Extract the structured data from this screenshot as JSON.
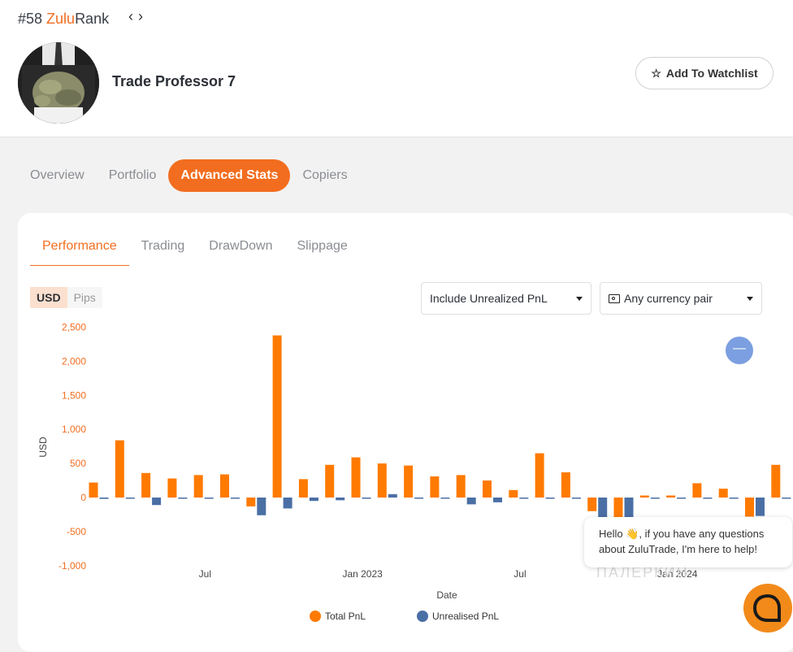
{
  "header": {
    "rank_prefix": "#58 ",
    "rank_brand": "Zulu",
    "rank_suffix": "Rank",
    "trader_name": "Trade Professor 7",
    "watchlist_label": "Add To Watchlist"
  },
  "tabs": [
    "Overview",
    "Portfolio",
    "Advanced Stats",
    "Copiers"
  ],
  "subtabs": [
    "Performance",
    "Trading",
    "DrawDown",
    "Slippage"
  ],
  "unit_toggle": {
    "usd": "USD",
    "pips": "Pips"
  },
  "filters": {
    "pnl": "Include Unrealized PnL",
    "currency": "Any currency pair"
  },
  "chat": {
    "message": "Hello 👋, if you have any questions about ZuluTrade, I'm here to help!",
    "watermark": "ПАЛЕРКИН"
  },
  "colors": {
    "accent": "#f26d1f",
    "total": "#ff7a00",
    "unrealised": "#4a6fa5"
  },
  "chart_data": {
    "type": "bar",
    "xlabel": "Date",
    "ylabel": "USD",
    "ylim": [
      -1000,
      2500
    ],
    "yticks": [
      2500,
      2000,
      1500,
      1000,
      500,
      0,
      -500,
      -1000
    ],
    "ytick_labels": [
      "2,500",
      "2,000",
      "1,500",
      "1,000",
      "500",
      "0",
      "-500",
      "-1,000"
    ],
    "xtick_labels": [
      {
        "label": "Jul",
        "index": 4.5
      },
      {
        "label": "Jan 2023",
        "index": 10.5
      },
      {
        "label": "Jul",
        "index": 16.5
      },
      {
        "label": "Jan 2024",
        "index": 22.5
      }
    ],
    "series": [
      {
        "name": "Total PnL",
        "values": [
          220,
          840,
          360,
          280,
          330,
          340,
          -130,
          2380,
          270,
          480,
          590,
          500,
          470,
          310,
          330,
          250,
          110,
          650,
          370,
          -200,
          -300,
          30,
          30,
          210,
          130,
          -280,
          480
        ]
      },
      {
        "name": "Unrealised PnL",
        "values": [
          -20,
          0,
          -110,
          0,
          0,
          -10,
          -260,
          -160,
          -50,
          -40,
          0,
          50,
          0,
          0,
          -100,
          -70,
          0,
          0,
          0,
          -290,
          -290,
          0,
          0,
          0,
          0,
          -270,
          0
        ]
      }
    ]
  }
}
